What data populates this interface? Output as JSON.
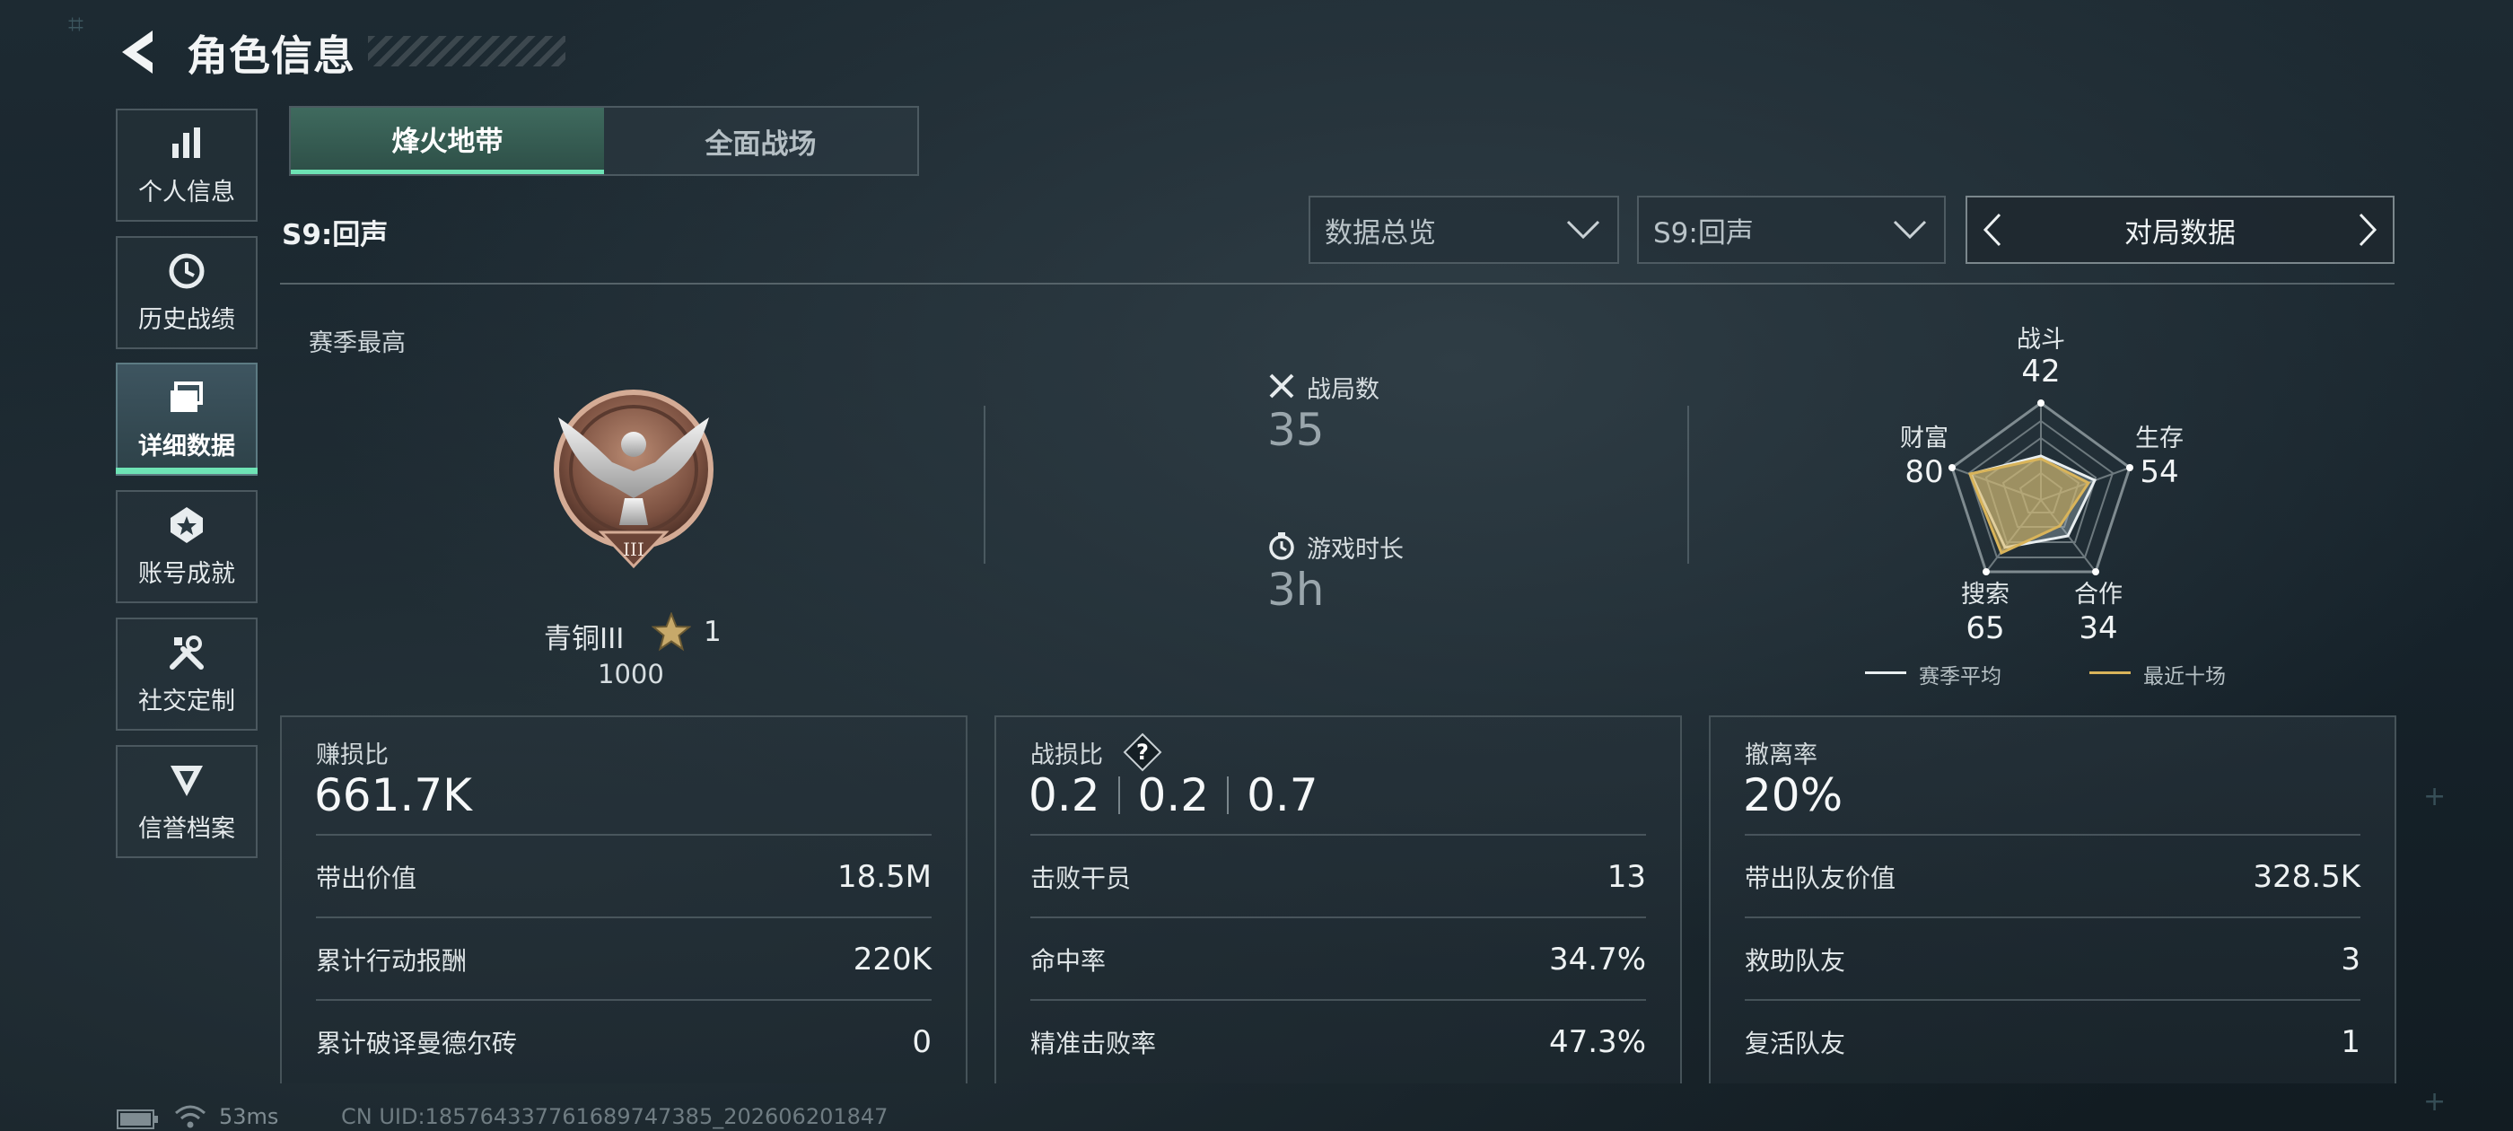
{
  "header": {
    "title": "角色信息"
  },
  "sidebar": {
    "items": [
      {
        "label": "个人信息",
        "icon": "bar-chart-icon"
      },
      {
        "label": "历史战绩",
        "icon": "history-clock-icon"
      },
      {
        "label": "详细数据",
        "icon": "folder-data-icon",
        "active": true
      },
      {
        "label": "账号成就",
        "icon": "achievement-badge-icon"
      },
      {
        "label": "社交定制",
        "icon": "wrench-tools-icon"
      },
      {
        "label": "信誉档案",
        "icon": "credit-shield-icon"
      }
    ]
  },
  "mode_tabs": [
    {
      "label": "烽火地带",
      "active": true
    },
    {
      "label": "全面战场",
      "active": false
    }
  ],
  "season_title": "S9:回声",
  "filters": {
    "overview": "数据总览",
    "season": "S9:回声",
    "pager_label": "对局数据"
  },
  "season_best": {
    "label": "赛季最高",
    "rank_name": "青铜III",
    "rank_stars": "1",
    "rank_score": "1000"
  },
  "match_stats": {
    "matches_label": "战局数",
    "matches_value": "35",
    "playtime_label": "游戏时长",
    "playtime_value": "3h"
  },
  "radar": {
    "axes": [
      {
        "label": "战斗",
        "value": "42"
      },
      {
        "label": "生存",
        "value": "54"
      },
      {
        "label": "合作",
        "value": "34"
      },
      {
        "label": "搜索",
        "value": "65"
      },
      {
        "label": "财富",
        "value": "80"
      }
    ],
    "legend": [
      {
        "label": "赛季平均",
        "color": "#e8eef0"
      },
      {
        "label": "最近十场",
        "color": "#d9b45a"
      }
    ]
  },
  "panels": [
    {
      "title": "赚损比",
      "big": "661.7K",
      "rows": [
        {
          "k": "带出价值",
          "v": "18.5M"
        },
        {
          "k": "累计行动报酬",
          "v": "220K"
        },
        {
          "k": "累计破译曼德尔砖",
          "v": "0"
        }
      ]
    },
    {
      "title": "战损比",
      "ratios": [
        "0.2",
        "0.2",
        "0.7"
      ],
      "rows": [
        {
          "k": "击败干员",
          "v": "13"
        },
        {
          "k": "命中率",
          "v": "34.7%"
        },
        {
          "k": "精准击败率",
          "v": "47.3%"
        }
      ]
    },
    {
      "title": "撤离率",
      "big": "20%",
      "rows": [
        {
          "k": "带出队友价值",
          "v": "328.5K"
        },
        {
          "k": "救助队友",
          "v": "3"
        },
        {
          "k": "复活队友",
          "v": "1"
        }
      ]
    }
  ],
  "footer": {
    "ping": "53ms",
    "uid": "CN UID:18576433776168974738​5_202606201847"
  },
  "colors": {
    "accent": "#6ee3b5",
    "gold": "#d9b45a"
  }
}
